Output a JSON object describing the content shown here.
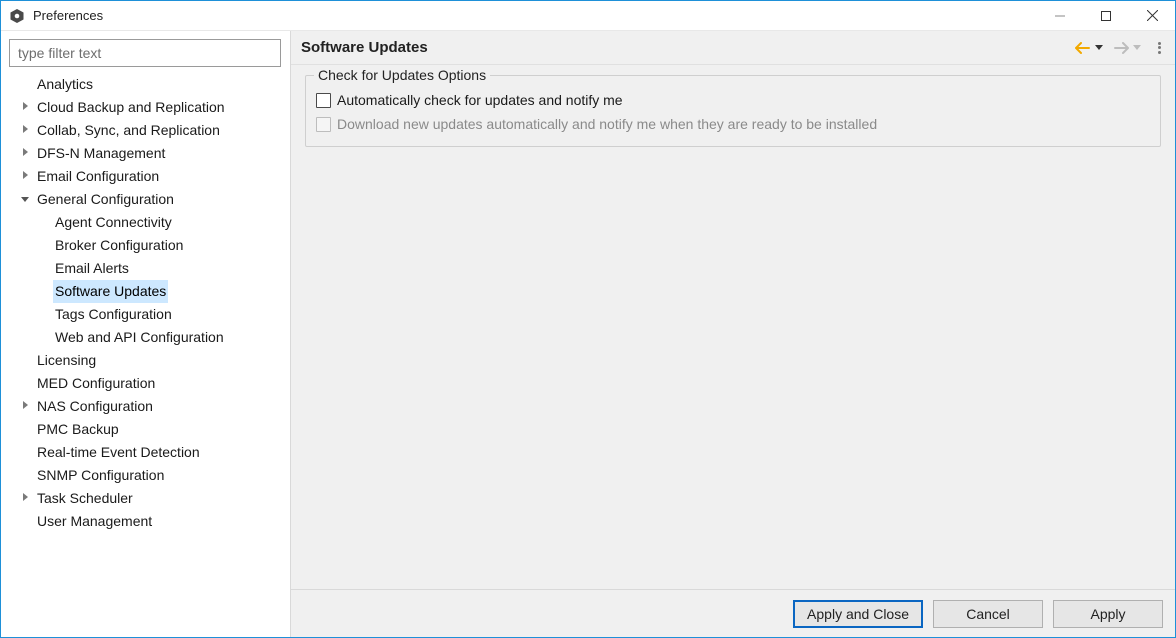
{
  "window": {
    "title": "Preferences"
  },
  "filter": {
    "placeholder": "type filter text"
  },
  "tree": [
    {
      "label": "Analytics",
      "depth": 0,
      "expander": ""
    },
    {
      "label": "Cloud Backup and Replication",
      "depth": 0,
      "expander": ">"
    },
    {
      "label": "Collab, Sync, and Replication",
      "depth": 0,
      "expander": ">"
    },
    {
      "label": "DFS-N Management",
      "depth": 0,
      "expander": ">"
    },
    {
      "label": "Email Configuration",
      "depth": 0,
      "expander": ">"
    },
    {
      "label": "General Configuration",
      "depth": 0,
      "expander": "v"
    },
    {
      "label": "Agent Connectivity",
      "depth": 1,
      "expander": ""
    },
    {
      "label": "Broker Configuration",
      "depth": 1,
      "expander": ""
    },
    {
      "label": "Email Alerts",
      "depth": 1,
      "expander": ""
    },
    {
      "label": "Software Updates",
      "depth": 1,
      "expander": "",
      "selected": true
    },
    {
      "label": "Tags Configuration",
      "depth": 1,
      "expander": ""
    },
    {
      "label": "Web and API Configuration",
      "depth": 1,
      "expander": ""
    },
    {
      "label": "Licensing",
      "depth": 0,
      "expander": ""
    },
    {
      "label": "MED Configuration",
      "depth": 0,
      "expander": ""
    },
    {
      "label": "NAS Configuration",
      "depth": 0,
      "expander": ">"
    },
    {
      "label": "PMC Backup",
      "depth": 0,
      "expander": ""
    },
    {
      "label": "Real-time Event Detection",
      "depth": 0,
      "expander": ""
    },
    {
      "label": "SNMP Configuration",
      "depth": 0,
      "expander": ""
    },
    {
      "label": "Task Scheduler",
      "depth": 0,
      "expander": ">"
    },
    {
      "label": "User Management",
      "depth": 0,
      "expander": ""
    }
  ],
  "page": {
    "title": "Software Updates",
    "group_title": "Check for Updates Options",
    "opt_auto_check": "Automatically check for updates and notify me",
    "opt_auto_download": "Download new updates automatically and notify me when they are ready to be installed"
  },
  "nav": {
    "back_color": "#f2a900",
    "forward_color": "#bdbdbd"
  },
  "buttons": {
    "apply_close": "Apply and Close",
    "cancel": "Cancel",
    "apply": "Apply"
  }
}
